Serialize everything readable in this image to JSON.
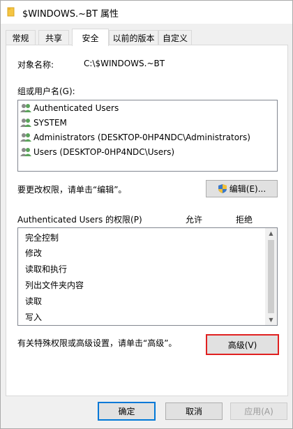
{
  "window": {
    "title": "$WINDOWS.~BT 属性"
  },
  "tabs": [
    {
      "label": "常规"
    },
    {
      "label": "共享"
    },
    {
      "label": "安全"
    },
    {
      "label": "以前的版本"
    },
    {
      "label": "自定义"
    }
  ],
  "object": {
    "label": "对象名称:",
    "value": "C:\\$WINDOWS.~BT"
  },
  "groups": {
    "label": "组或用户名(G):",
    "items": [
      {
        "label": "Authenticated Users"
      },
      {
        "label": "SYSTEM"
      },
      {
        "label": "Administrators (DESKTOP-0HP4NDC\\Administrators)"
      },
      {
        "label": "Users (DESKTOP-0HP4NDC\\Users)"
      }
    ]
  },
  "edit": {
    "hint": "要更改权限，请单击“编辑”。",
    "button": "编辑(E)..."
  },
  "permissions": {
    "title": "Authenticated Users 的权限(P)",
    "allow_header": "允许",
    "deny_header": "拒绝",
    "items": [
      {
        "label": "完全控制"
      },
      {
        "label": "修改"
      },
      {
        "label": "读取和执行"
      },
      {
        "label": "列出文件夹内容"
      },
      {
        "label": "读取"
      },
      {
        "label": "写入"
      }
    ]
  },
  "advanced": {
    "hint": "有关特殊权限或高级设置，请单击“高级”。",
    "button": "高级(V)"
  },
  "footer": {
    "ok": "确定",
    "cancel": "取消",
    "apply": "应用(A)"
  },
  "colors": {
    "highlight_border": "#e02020",
    "default_button_border": "#0078d7"
  }
}
